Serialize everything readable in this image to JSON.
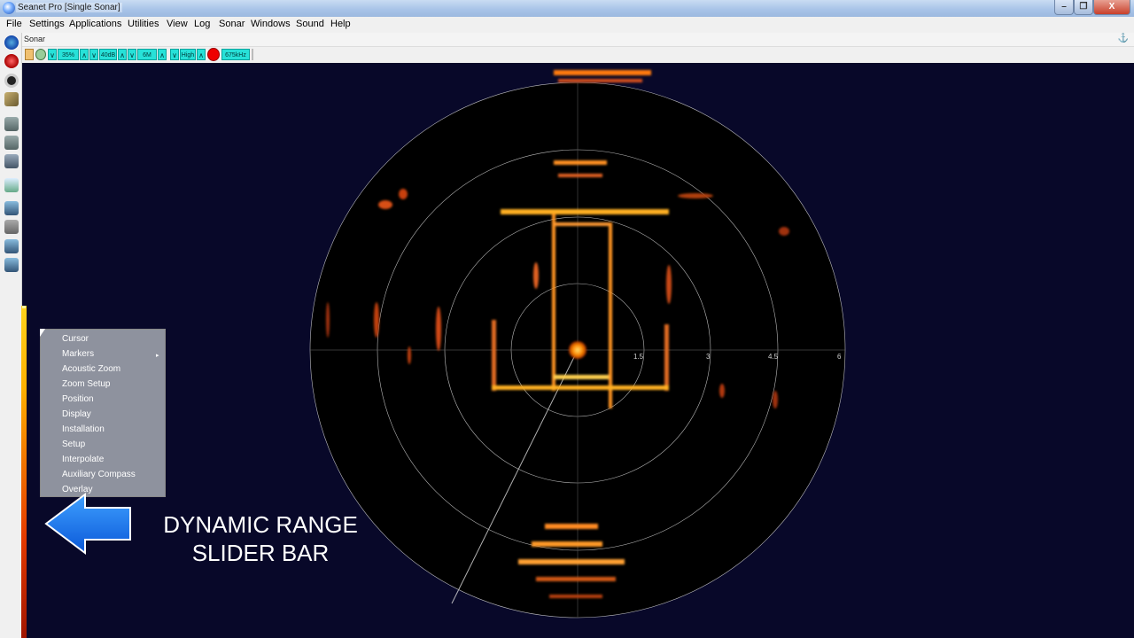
{
  "window": {
    "title": "Seanet Pro [Single Sonar]",
    "min": "–",
    "max": "❐",
    "close": "X"
  },
  "menu": [
    "File",
    "Settings",
    "Applications",
    "Utilities",
    "View",
    "Log",
    "Sonar",
    "Windows",
    "Sound",
    "Help"
  ],
  "sonar_panel": {
    "tab": "Sonar",
    "pin": "⚓"
  },
  "sonar_toolbar": {
    "gain": "35%",
    "contrast": "40dB",
    "range": "6M",
    "resolution": "High",
    "frequency": "675kHz"
  },
  "plot": {
    "range_labels": [
      "1.5",
      "3",
      "4.5",
      "6"
    ]
  },
  "context_menu": {
    "items": [
      "Cursor",
      "Markers",
      "Acoustic Zoom",
      "Zoom Setup",
      "Position",
      "Display",
      "Installation",
      "Setup",
      "Interpolate",
      "Auxiliary Compass",
      "Overlay"
    ],
    "submenu_arrow": "▸"
  },
  "annotation": {
    "line1": "DYNAMIC RANGE",
    "line2": "SLIDER BAR"
  },
  "colors": {
    "accent_cyan": "#27e1d8",
    "sonar_bg": "#080829",
    "echo": "#ff8a00"
  }
}
